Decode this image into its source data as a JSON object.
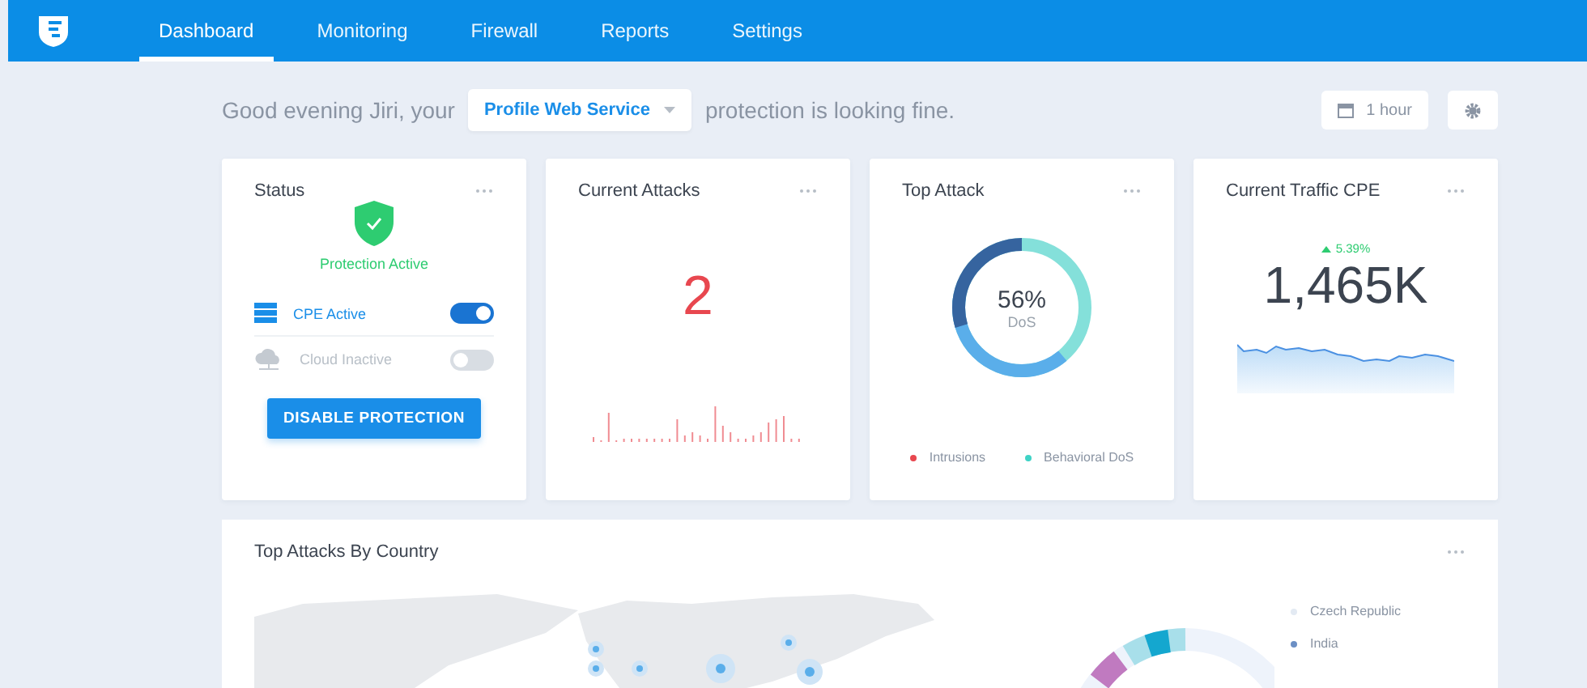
{
  "nav": {
    "tabs": [
      {
        "label": "Dashboard",
        "selected": true
      },
      {
        "label": "Monitoring",
        "selected": false
      },
      {
        "label": "Firewall",
        "selected": false
      },
      {
        "label": "Reports",
        "selected": false
      },
      {
        "label": "Settings",
        "selected": false
      }
    ]
  },
  "greeting": {
    "before": "Good evening Jiri, your",
    "service": "Profile Web Service",
    "after": "protection is looking fine."
  },
  "time_range": "1 hour",
  "cards": [
    {
      "kind": "status",
      "title": "Status",
      "status_text": "Protection Active",
      "toggles": [
        {
          "kind": "server",
          "label": "CPE Active",
          "on": true
        },
        {
          "kind": "cloud",
          "label": "Cloud Inactive",
          "on": false
        }
      ],
      "button": "DISABLE PROTECTION"
    },
    {
      "kind": "count",
      "title": "Current Attacks",
      "value": "2"
    },
    {
      "kind": "donut",
      "title": "Top Attack",
      "center_value": "56%",
      "center_label": "DoS",
      "legend": [
        {
          "label": "Intrusions",
          "color": "#e8474f"
        },
        {
          "label": "Behavioral DoS",
          "color": "#3fd3c6"
        }
      ]
    },
    {
      "kind": "traffic",
      "title": "Current Traffic CPE",
      "change": "5.39%",
      "value": "1,465K"
    }
  ],
  "country_panel": {
    "title": "Top Attacks By Country",
    "legend": [
      {
        "label": "Czech Republic",
        "color": "#e3eaf3"
      },
      {
        "label": "India",
        "color": "#6c8fc4"
      }
    ]
  }
}
